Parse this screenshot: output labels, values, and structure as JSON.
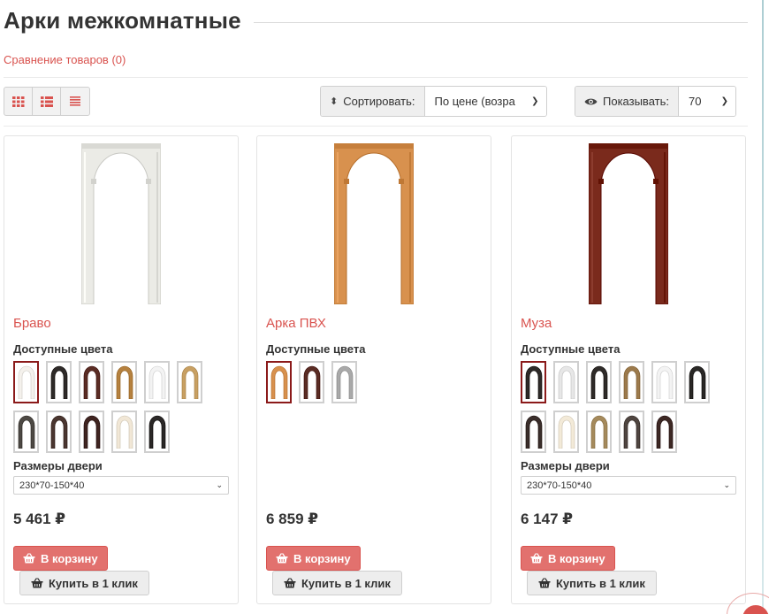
{
  "page": {
    "title": "Арки межкомнатные",
    "compare_link": "Сравнение товаров (0)"
  },
  "toolbar": {
    "view_modes": [
      "grid",
      "list",
      "compact"
    ],
    "sort": {
      "label": "Сортировать:",
      "value": "По цене (возра"
    },
    "show": {
      "label": "Показывать:",
      "value": "70"
    }
  },
  "common": {
    "colors_label": "Доступные цвета",
    "size_label": "Размеры двери",
    "cart_label": "В корзину",
    "one_click_label": "Купить в 1 клик"
  },
  "products": [
    {
      "name": "Браво",
      "price": "5 461 ₽",
      "size": "230*70-150*40",
      "frame_color": "#ebebe6",
      "selected_swatch": 0,
      "swatches": [
        "#f4f1ec",
        "#2e2a28",
        "#5a2c24",
        "#b5813f",
        "#f3f3f3",
        "#c8a063",
        "#4d4944",
        "#4a3630",
        "#3f2420",
        "#f1e7d6",
        "#2b2827"
      ]
    },
    {
      "name": "Арка ПВХ",
      "price": "6 859 ₽",
      "size": "",
      "frame_color": "#d8914e",
      "selected_swatch": 0,
      "swatches": [
        "#d8914e",
        "#5a2c24",
        "#a9a9a9"
      ]
    },
    {
      "name": "Муза",
      "price": "6 147 ₽",
      "size": "230*70-150*40",
      "frame_color": "#7a2a1c",
      "selected_swatch": 0,
      "swatches": [
        "#2e2a28",
        "#e7e7e7",
        "#2f2b29",
        "#9c7a4c",
        "#f3f3f3",
        "#2a2826",
        "#3a2e2b",
        "#f3ead8",
        "#a58a5c",
        "#4f4540",
        "#3d2824"
      ]
    }
  ]
}
